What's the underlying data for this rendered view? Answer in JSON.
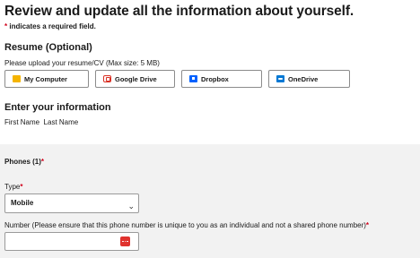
{
  "header": {
    "title": "Review and update all the information about yourself.",
    "required_star": "*",
    "required_note": " indicates a required field."
  },
  "resume": {
    "heading": "Resume (Optional)",
    "instructions": "Please upload your resume/CV (Max size: 5 MB)",
    "buttons": [
      {
        "label": "My Computer",
        "icon": "folder-icon"
      },
      {
        "label": "Google Drive",
        "icon": "google-drive-icon"
      },
      {
        "label": "Dropbox",
        "icon": "dropbox-icon"
      },
      {
        "label": "OneDrive",
        "icon": "onedrive-icon"
      }
    ]
  },
  "info": {
    "heading": "Enter your information",
    "name_line": "First Name  Last Name"
  },
  "phones": {
    "heading": "Phones (1)",
    "required_star": "*",
    "type_label": "Type",
    "type_value": "Mobile",
    "number_label": "Number (Please ensure that this phone number is unique to you as an individual and not a shared phone number)",
    "number_value": ""
  },
  "colors": {
    "required": "#d0021b",
    "panel_bg": "#f2f2f2",
    "input_icon": "#e0322e"
  }
}
